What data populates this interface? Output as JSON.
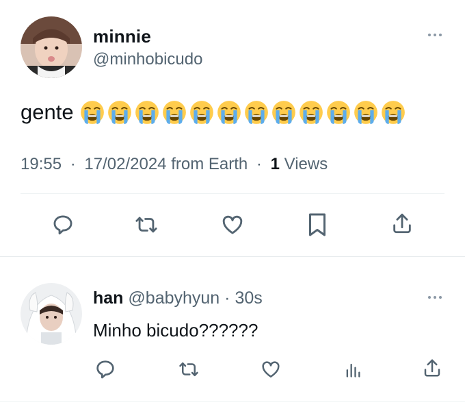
{
  "main_tweet": {
    "author": {
      "display_name": "minnie",
      "handle": "@minhobicudo",
      "avatar": "avatar-photo"
    },
    "more_icon": "more-horizontal-icon",
    "text": "gente",
    "emoji": {
      "name": "loudly-crying-face-emoji",
      "count": 12
    },
    "meta": {
      "time": "19:55",
      "sep1": "·",
      "date": "17/02/2024",
      "from_label": "from",
      "location": "Earth",
      "sep2": "·",
      "views_count": "1",
      "views_label": "Views"
    },
    "actions": [
      "reply-icon",
      "retweet-icon",
      "like-icon",
      "bookmark-icon",
      "share-icon"
    ]
  },
  "reply": {
    "author": {
      "display_name": "han",
      "handle": "@babyhyun",
      "avatar": "avatar-photo"
    },
    "sep": "·",
    "time": "30s",
    "text": "Minho bicudo??????",
    "more_icon": "more-horizontal-icon",
    "actions": [
      "reply-icon",
      "retweet-icon",
      "like-icon",
      "analytics-icon",
      "share-icon"
    ]
  },
  "colors": {
    "text_primary": "#0f1419",
    "text_secondary": "#536471",
    "icon": "#536471",
    "divider": "#eff3f4",
    "emoji_face": "#ffcc4d",
    "emoji_tears": "#5dadec"
  }
}
